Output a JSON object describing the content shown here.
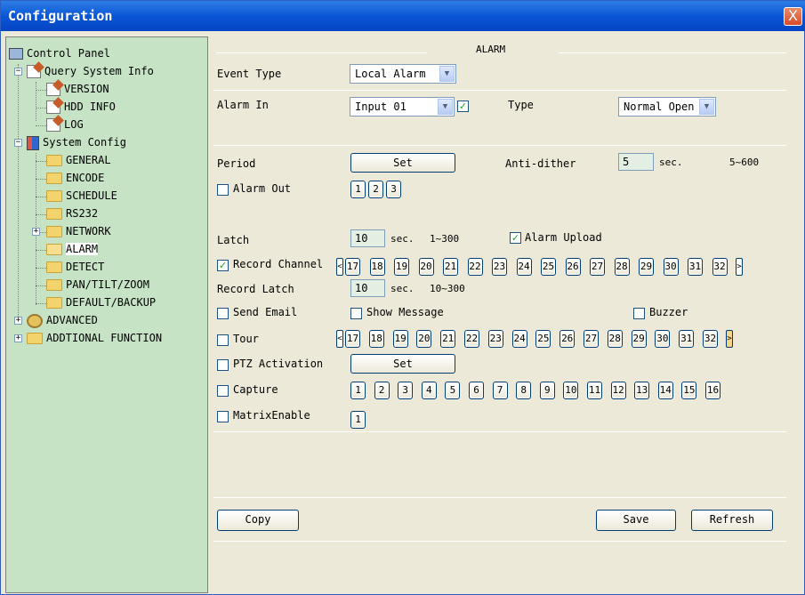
{
  "window": {
    "title": "Configuration",
    "close_glyph": "X"
  },
  "sidebar": {
    "items": [
      {
        "label": "Control Panel"
      },
      {
        "label": "Query System Info"
      },
      {
        "label": "VERSION"
      },
      {
        "label": "HDD INFO"
      },
      {
        "label": "LOG"
      },
      {
        "label": "System Config"
      },
      {
        "label": "GENERAL"
      },
      {
        "label": "ENCODE"
      },
      {
        "label": "SCHEDULE"
      },
      {
        "label": "RS232"
      },
      {
        "label": "NETWORK"
      },
      {
        "label": "ALARM"
      },
      {
        "label": "DETECT"
      },
      {
        "label": "PAN/TILT/ZOOM"
      },
      {
        "label": "DEFAULT/BACKUP"
      },
      {
        "label": "ADVANCED"
      },
      {
        "label": "ADDTIONAL FUNCTION"
      }
    ],
    "selected": "ALARM"
  },
  "main": {
    "section_title": "ALARM",
    "event_type": {
      "label": "Event Type",
      "value": "Local Alarm"
    },
    "alarm_in": {
      "label": "Alarm In",
      "value": "Input 01",
      "checked": true
    },
    "type": {
      "label": "Type",
      "value": "Normal Open"
    },
    "period": {
      "label": "Period",
      "button": "Set"
    },
    "anti_dither": {
      "label": "Anti-dither",
      "value": "5",
      "unit": "sec.",
      "range": "5~600"
    },
    "alarm_out": {
      "label": "Alarm Out",
      "checked": false,
      "outputs": [
        "1",
        "2",
        "3"
      ]
    },
    "latch": {
      "label": "Latch",
      "value": "10",
      "unit": "sec.",
      "range": "1~300"
    },
    "alarm_upload": {
      "label": "Alarm Upload",
      "checked": true
    },
    "record_channel": {
      "label": "Record Channel",
      "checked": true,
      "channels": [
        "17",
        "18",
        "19",
        "20",
        "21",
        "22",
        "23",
        "24",
        "25",
        "26",
        "27",
        "28",
        "29",
        "30",
        "31",
        "32"
      ],
      "prev": "<",
      "next": ">"
    },
    "record_latch": {
      "label": "Record Latch",
      "value": "10",
      "unit": "sec.",
      "range": "10~300"
    },
    "send_email": {
      "label": "Send Email",
      "checked": false
    },
    "show_message": {
      "label": "Show Message",
      "checked": false
    },
    "buzzer": {
      "label": "Buzzer",
      "checked": false
    },
    "tour": {
      "label": "Tour",
      "checked": false,
      "channels": [
        "17",
        "18",
        "19",
        "20",
        "21",
        "22",
        "23",
        "24",
        "25",
        "26",
        "27",
        "28",
        "29",
        "30",
        "31",
        "32"
      ],
      "prev": "<",
      "next": ">"
    },
    "ptz_activation": {
      "label": "PTZ Activation",
      "checked": false,
      "button": "Set"
    },
    "capture": {
      "label": "Capture",
      "checked": false,
      "channels": [
        "1",
        "2",
        "3",
        "4",
        "5",
        "6",
        "7",
        "8",
        "9",
        "10",
        "11",
        "12",
        "13",
        "14",
        "15",
        "16"
      ]
    },
    "matrix": {
      "label": "MatrixEnable",
      "checked": false,
      "outputs": [
        "1"
      ]
    },
    "buttons": {
      "copy": "Copy",
      "save": "Save",
      "refresh": "Refresh"
    }
  },
  "colors": {
    "sidebar_bg": "#c6e3c6",
    "titlebar": "#0a56d6",
    "checkmark": "#21a121",
    "panel_bg": "#ece9d8"
  }
}
